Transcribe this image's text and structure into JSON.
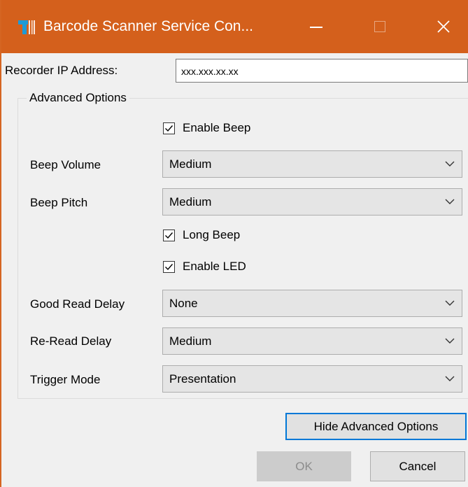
{
  "window": {
    "title": "Barcode Scanner Service Con...",
    "accent_color": "#d4601c",
    "controls": [
      "minimize-icon",
      "maximize-icon",
      "close-icon"
    ]
  },
  "recorder": {
    "label": "Recorder IP Address:",
    "value": "xxx.xxx.xx.xx"
  },
  "advanced": {
    "group_label": "Advanced Options",
    "enable_beep": {
      "label": "Enable Beep",
      "checked": true
    },
    "beep_volume": {
      "label": "Beep Volume",
      "value": "Medium"
    },
    "beep_pitch": {
      "label": "Beep Pitch",
      "value": "Medium"
    },
    "long_beep": {
      "label": "Long Beep",
      "checked": true
    },
    "enable_led": {
      "label": "Enable LED",
      "checked": true
    },
    "good_read_delay": {
      "label": "Good Read Delay",
      "value": "None"
    },
    "reread_delay": {
      "label": "Re-Read Delay",
      "value": "Medium"
    },
    "trigger_mode": {
      "label": "Trigger Mode",
      "value": "Presentation"
    }
  },
  "buttons": {
    "hide_advanced": "Hide Advanced Options",
    "ok": "OK",
    "ok_enabled": false,
    "cancel": "Cancel"
  }
}
